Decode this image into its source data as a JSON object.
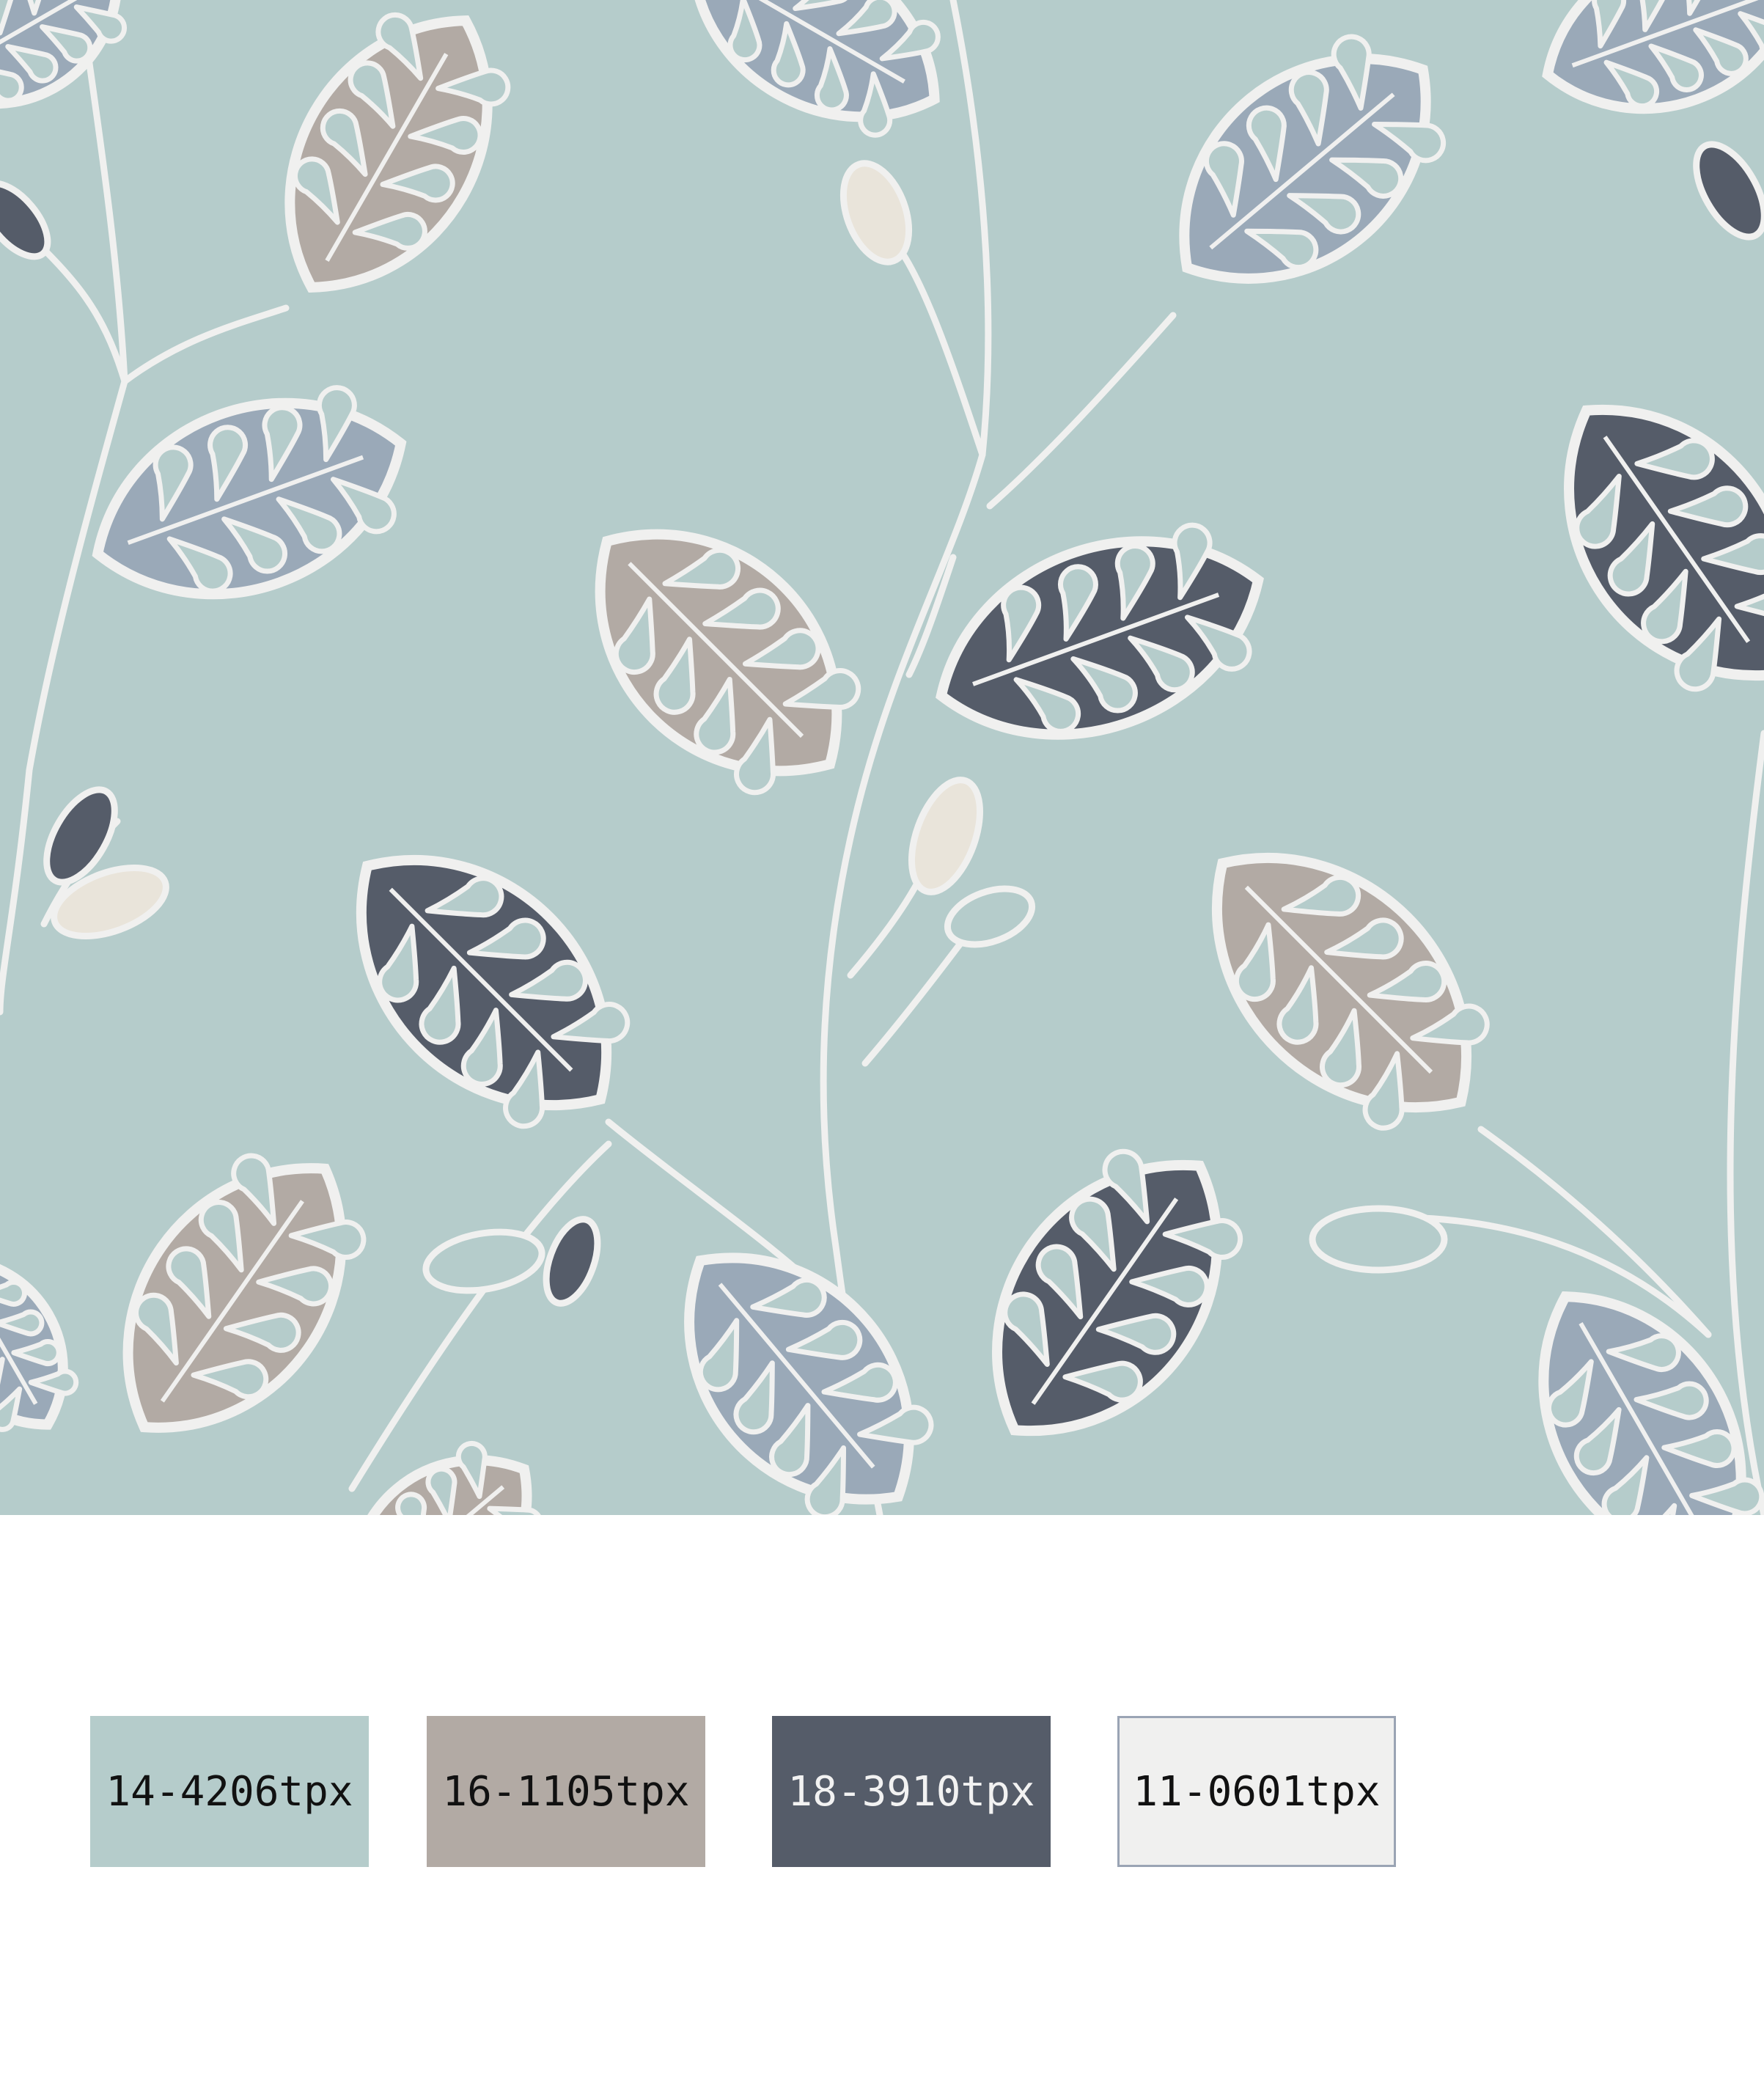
{
  "pattern": {
    "background": "#b5cccb",
    "outline": "#f0f0ef",
    "leaf_colors": [
      "#b2aaa4",
      "#9aa9b8",
      "#555c69"
    ],
    "bud_color": "#e9e4da"
  },
  "swatches": [
    {
      "code": "14-4206tpx",
      "color": "#b5cccb",
      "text_color": "#111111"
    },
    {
      "code": "16-1105tpx",
      "color": "#b2aaa4",
      "text_color": "#111111"
    },
    {
      "code": "18-3910tpx",
      "color": "#555c69",
      "text_color": "#f2f2f2"
    },
    {
      "code": "11-0601tpx",
      "color": "#f0f0ef",
      "text_color": "#111111"
    }
  ]
}
